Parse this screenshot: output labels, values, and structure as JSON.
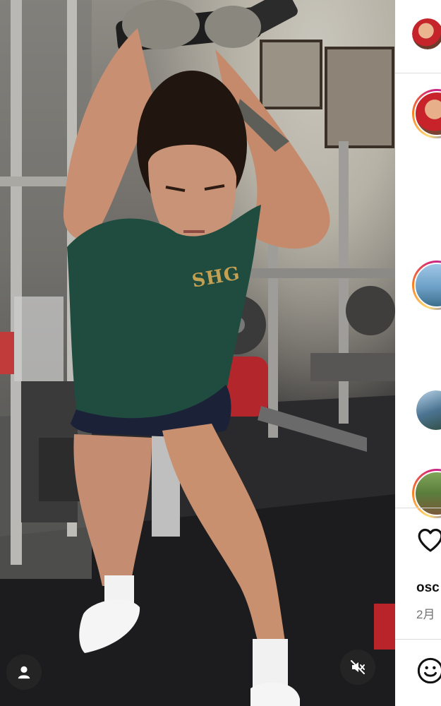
{
  "video": {
    "shirt_logo": "SHG",
    "profile_icon": "person-icon",
    "mute_icon": "speaker-muted-icon"
  },
  "sidebar": {
    "stories": [
      {
        "name": "story-avatar-1",
        "ring": false
      },
      {
        "name": "story-avatar-2",
        "ring": true
      },
      {
        "name": "story-avatar-3",
        "ring": true
      },
      {
        "name": "story-avatar-4",
        "ring": false
      },
      {
        "name": "story-avatar-5",
        "ring": true
      }
    ]
  },
  "post": {
    "like_icon": "heart-icon",
    "username": "osc",
    "date": "2月",
    "emoji_icon": "emoji-icon"
  },
  "colors": {
    "story_ring_start": "#feda75",
    "story_ring_end": "#d62976",
    "shirt": "#1f4c3f",
    "shorts": "#1b2238"
  }
}
